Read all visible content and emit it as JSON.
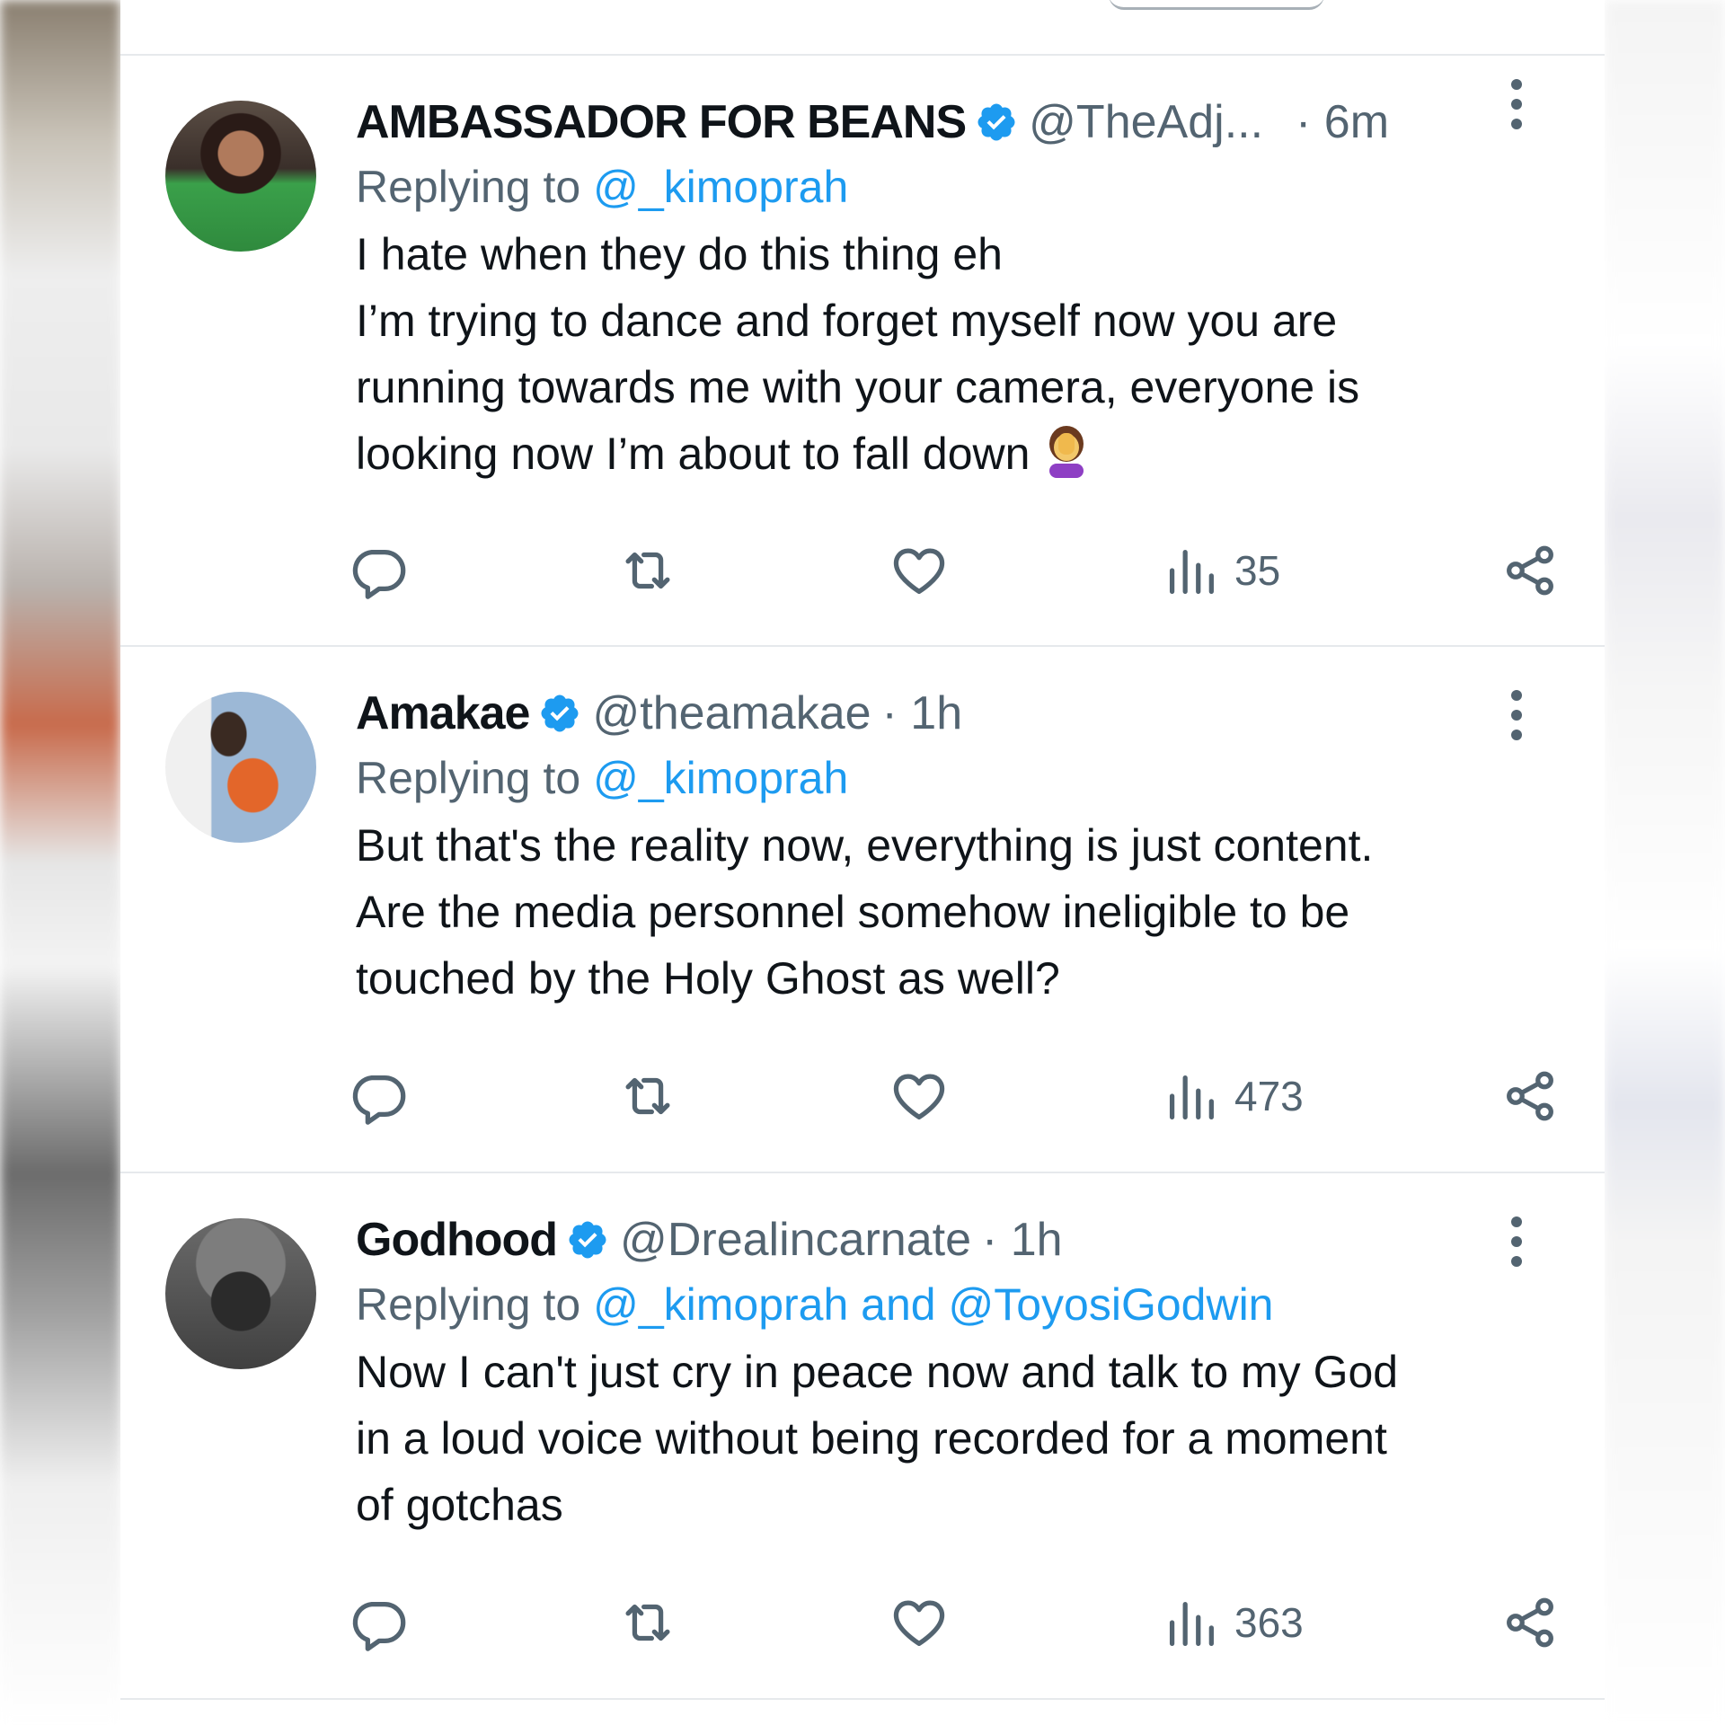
{
  "colors": {
    "text": "#0f1419",
    "muted": "#536471",
    "link": "#1d9bf0",
    "divider": "#e6e9ec"
  },
  "posts": [
    {
      "name": "AMBASSADOR FOR BEANS",
      "handle": "@TheAdj...",
      "time": "· 6m",
      "reply_prefix": "Replying to",
      "reply_to": "@_kimoprah",
      "lines": [
        "I hate when they do this thing eh",
        "I’m trying to dance and forget myself now you are",
        "running towards me with your camera, everyone is",
        "looking now I’m about to fall down"
      ],
      "emoji": "face-palm-emoji",
      "views": "35"
    },
    {
      "name": "Amakae",
      "handle": "@theamakae",
      "time": "· 1h",
      "reply_prefix": "Replying to",
      "reply_to": "@_kimoprah",
      "lines": [
        "But that's the reality now, everything is  just content.",
        "Are the media personnel somehow ineligible to be",
        "touched by the Holy Ghost as well?"
      ],
      "views": "473"
    },
    {
      "name": "Godhood",
      "handle": "@Drealincarnate",
      "time": "· 1h",
      "reply_prefix": "Replying to",
      "reply_to": "@_kimoprah and @ToyosiGodwin",
      "lines": [
        "Now I can't just cry in peace now and talk to my God",
        "in a loud voice without being recorded for a moment",
        "of gotchas"
      ],
      "views": "363"
    }
  ],
  "icons": {
    "reply": "reply-icon",
    "repost": "repost-icon",
    "like": "like-icon",
    "views": "views-icon",
    "share": "share-icon",
    "verified": "verified-badge-icon",
    "more": "more-options-icon"
  }
}
